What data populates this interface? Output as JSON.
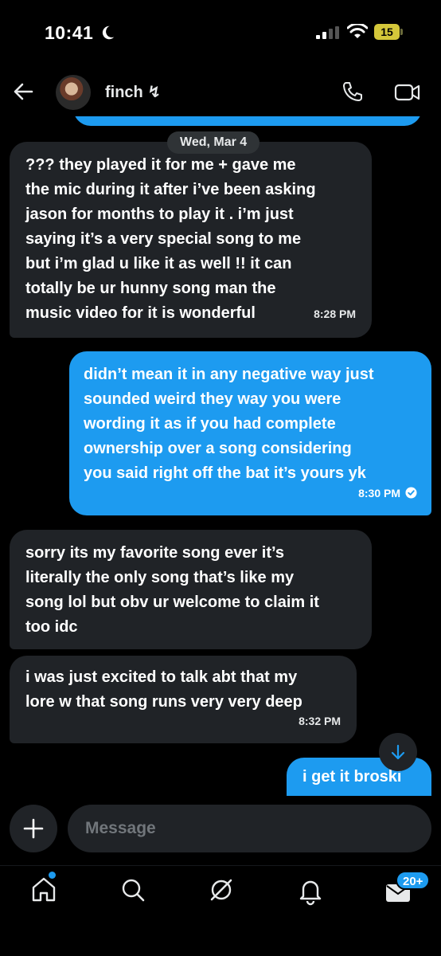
{
  "status_bar": {
    "time": "10:41",
    "battery": "15"
  },
  "header": {
    "contact_name": "finch ↯"
  },
  "conversation": {
    "date_divider": "Wed, Mar 4",
    "messages": [
      {
        "direction": "in",
        "lines": [
          "??? they played it for me + gave me",
          "the mic during it after i’ve been asking",
          "jason for months to play it . i’m just",
          "saying it’s a very special song to me",
          "but i’m glad u like it as well !! it can",
          "totally be ur hunny song man the",
          "music video for it is wonderful"
        ],
        "time": "8:28 PM"
      },
      {
        "direction": "out",
        "lines": [
          "didn’t mean it in any negative way just",
          "sounded weird they way you were",
          "wording it as if you had complete",
          "ownership over a song considering",
          "you said right off the bat it’s yours yk"
        ],
        "time": "8:30 PM"
      },
      {
        "direction": "in",
        "lines": [
          "sorry its my favorite song ever it’s",
          "literally the only song that’s like my",
          "song lol but obv ur welcome to claim it",
          "too idc"
        ],
        "time": ""
      },
      {
        "direction": "in",
        "lines": [
          "i was just excited to talk abt that my",
          "lore w that song runs very very deep"
        ],
        "time": "8:32 PM"
      },
      {
        "direction": "out",
        "lines": [
          "i get it broski"
        ],
        "time": ""
      }
    ]
  },
  "composer": {
    "placeholder": "Message"
  },
  "tabbar": {
    "messages_badge": "20+"
  },
  "colors": {
    "accent": "#1d9bf0",
    "incoming_bubble": "#202327",
    "background": "#000000"
  },
  "icons": [
    "back-arrow-icon",
    "phone-icon",
    "video-icon",
    "chevron-down-icon",
    "plus-icon",
    "home-icon",
    "search-icon",
    "grok-icon",
    "bell-icon",
    "mail-icon"
  ]
}
